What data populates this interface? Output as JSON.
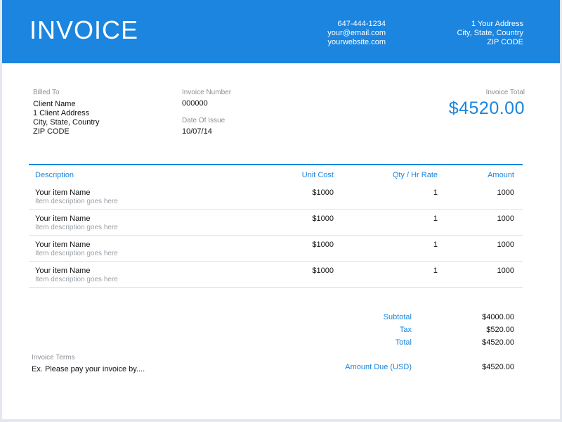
{
  "header": {
    "title": "INVOICE",
    "phone": "647-444-1234",
    "email": "your@email.com",
    "website": "yourwebsite.com",
    "address_line1": "1 Your Address",
    "address_line2": "City, State, Country",
    "address_line3": "ZIP CODE"
  },
  "billed_to": {
    "label": "Billed To",
    "name": "Client Name",
    "address": "1 Client Address",
    "city": "City, State, Country",
    "zip": "ZIP CODE"
  },
  "invoice_number": {
    "label": "Invoice Number",
    "value": "000000"
  },
  "date_of_issue": {
    "label": "Date Of Issue",
    "value": "10/07/14"
  },
  "invoice_total": {
    "label": "Invoice Total",
    "value": "$4520.00"
  },
  "table": {
    "headers": {
      "description": "Description",
      "unit_cost": "Unit Cost",
      "qty": "Qty / Hr Rate",
      "amount": "Amount"
    },
    "rows": [
      {
        "name": "Your item Name",
        "desc": "Item description goes here",
        "unit": "$1000",
        "qty": "1",
        "amount": "1000"
      },
      {
        "name": "Your item Name",
        "desc": "Item description goes here",
        "unit": "$1000",
        "qty": "1",
        "amount": "1000"
      },
      {
        "name": "Your item Name",
        "desc": "Item description goes here",
        "unit": "$1000",
        "qty": "1",
        "amount": "1000"
      },
      {
        "name": "Your item Name",
        "desc": "Item description goes here",
        "unit": "$1000",
        "qty": "1",
        "amount": "1000"
      }
    ]
  },
  "totals": {
    "subtotal_label": "Subtotal",
    "subtotal": "$4000.00",
    "tax_label": "Tax",
    "tax": "$520.00",
    "total_label": "Total",
    "total": "$4520.00",
    "amount_due_label": "Amount Due (USD)",
    "amount_due": "$4520.00"
  },
  "terms": {
    "label": "Invoice Terms",
    "text": "Ex. Please pay your invoice by...."
  },
  "colors": {
    "accent": "#1b85df"
  }
}
